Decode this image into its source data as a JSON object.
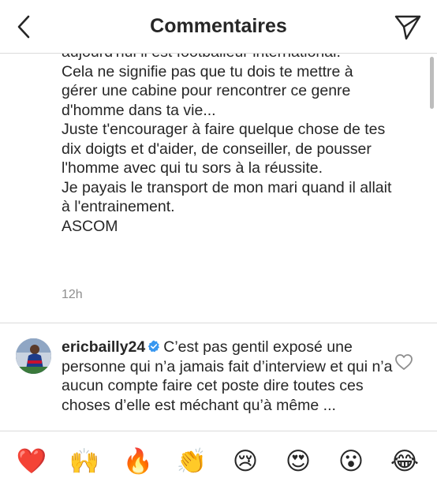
{
  "header": {
    "title": "Commentaires",
    "back_icon": "chevron-left-icon",
    "share_icon": "paper-plane-icon"
  },
  "comment1": {
    "lines": [
      "aujourd'hui il est footballeur international.",
      "Cela ne signifie pas que tu dois te mettre à gérer une cabine pour rencontrer ce genre d'homme dans ta vie...",
      "Juste t'encourager à faire quelque chose de tes dix doigts et d'aider, de conseiller, de pousser l'homme avec qui tu sors à la réussite.",
      "Je payais le transport de mon mari quand il allait à l'entrainement.",
      "ASCOM"
    ],
    "time": "12h"
  },
  "comment2": {
    "username": "ericbailly24",
    "verified_icon": "verified-badge-icon",
    "text": "C’est pas gentil exposé une personne qui n’a jamais fait d’interview et qui n’a aucun compte faire cet poste dire toutes ces choses  d’elle est méchant qu’à même ...",
    "like_icon": "heart-outline-icon"
  },
  "emoji_bar": {
    "emojis": [
      "❤️",
      "🙌",
      "🔥",
      "👏",
      "😢",
      "😍",
      "😮",
      "😂"
    ]
  },
  "colors": {
    "text": "#262626",
    "secondary": "#8e8e8e",
    "divider": "#dbdbdb",
    "verified": "#3897f0"
  }
}
